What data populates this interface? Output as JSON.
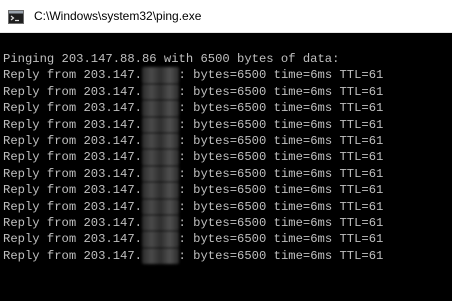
{
  "window": {
    "title": "C:\\Windows\\system32\\ping.exe",
    "icon": "console-app-icon"
  },
  "console": {
    "header": "Pinging 203.147.88.86 with 6500 bytes of data:",
    "replies": [
      {
        "prefix": "Reply from 203.147.",
        "masked": "88.86",
        "suffix": ": bytes=6500 time=6ms TTL=61"
      },
      {
        "prefix": "Reply from 203.147.",
        "masked": "88.86",
        "suffix": ": bytes=6500 time=6ms TTL=61"
      },
      {
        "prefix": "Reply from 203.147.",
        "masked": "88.86",
        "suffix": ": bytes=6500 time=6ms TTL=61"
      },
      {
        "prefix": "Reply from 203.147.",
        "masked": "88.86",
        "suffix": ": bytes=6500 time=6ms TTL=61"
      },
      {
        "prefix": "Reply from 203.147.",
        "masked": "88.86",
        "suffix": ": bytes=6500 time=6ms TTL=61"
      },
      {
        "prefix": "Reply from 203.147.",
        "masked": "88.86",
        "suffix": ": bytes=6500 time=6ms TTL=61"
      },
      {
        "prefix": "Reply from 203.147.",
        "masked": "88.86",
        "suffix": ": bytes=6500 time=6ms TTL=61"
      },
      {
        "prefix": "Reply from 203.147.",
        "masked": "88.86",
        "suffix": ": bytes=6500 time=6ms TTL=61"
      },
      {
        "prefix": "Reply from 203.147.",
        "masked": "88.86",
        "suffix": ": bytes=6500 time=6ms TTL=61"
      },
      {
        "prefix": "Reply from 203.147.",
        "masked": "88.86",
        "suffix": ": bytes=6500 time=6ms TTL=61"
      },
      {
        "prefix": "Reply from 203.147.",
        "masked": "88.86",
        "suffix": ": bytes=6500 time=6ms TTL=61"
      },
      {
        "prefix": "Reply from 203.147.",
        "masked": "88.86",
        "suffix": ": bytes=6500 time=6ms TTL=61"
      }
    ],
    "colors": {
      "background": "#000000",
      "text": "#c0c0c0"
    }
  }
}
